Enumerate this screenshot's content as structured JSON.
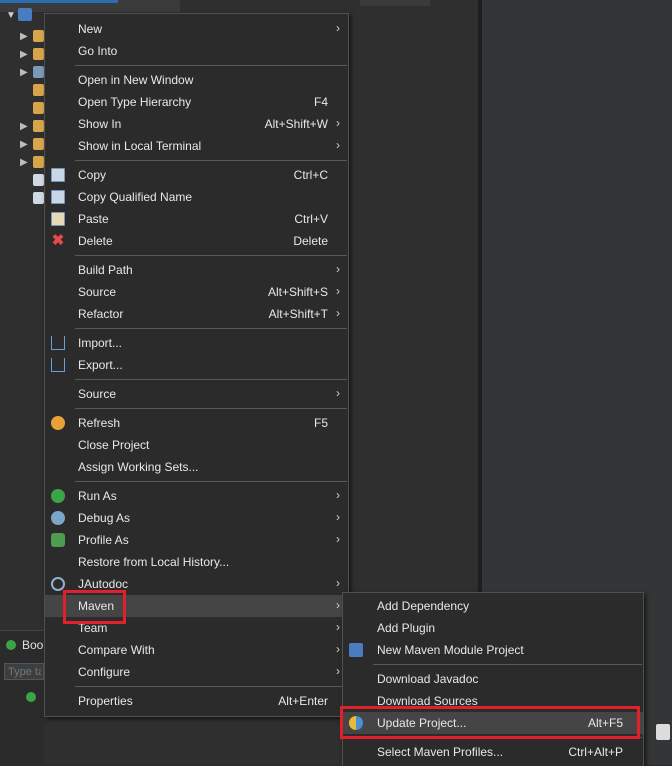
{
  "bottom_panel": {
    "tab_label": "Boo",
    "filter_placeholder": "Type ta"
  },
  "context_menu": {
    "items": [
      {
        "label": "New",
        "shortcut": "",
        "submenu": true
      },
      {
        "label": "Go Into",
        "shortcut": "",
        "submenu": false
      },
      {
        "label": "Open in New Window",
        "shortcut": "",
        "submenu": false
      },
      {
        "label": "Open Type Hierarchy",
        "shortcut": "F4",
        "submenu": false
      },
      {
        "label": "Show In",
        "shortcut": "Alt+Shift+W",
        "submenu": true
      },
      {
        "label": "Show in Local Terminal",
        "shortcut": "",
        "submenu": true
      },
      {
        "label": "Copy",
        "shortcut": "Ctrl+C",
        "submenu": false,
        "icon": "copy-icon"
      },
      {
        "label": "Copy Qualified Name",
        "shortcut": "",
        "submenu": false,
        "icon": "copy-qualified-name-icon"
      },
      {
        "label": "Paste",
        "shortcut": "Ctrl+V",
        "submenu": false,
        "icon": "paste-icon"
      },
      {
        "label": "Delete",
        "shortcut": "Delete",
        "submenu": false,
        "icon": "delete-icon"
      },
      {
        "label": "Build Path",
        "shortcut": "",
        "submenu": true
      },
      {
        "label": "Source",
        "shortcut": "Alt+Shift+S",
        "submenu": true
      },
      {
        "label": "Refactor",
        "shortcut": "Alt+Shift+T",
        "submenu": true
      },
      {
        "label": "Import...",
        "shortcut": "",
        "submenu": false,
        "icon": "import-icon"
      },
      {
        "label": "Export...",
        "shortcut": "",
        "submenu": false,
        "icon": "export-icon"
      },
      {
        "label": "Source",
        "shortcut": "",
        "submenu": true
      },
      {
        "label": "Refresh",
        "shortcut": "F5",
        "submenu": false,
        "icon": "refresh-icon"
      },
      {
        "label": "Close Project",
        "shortcut": "",
        "submenu": false
      },
      {
        "label": "Assign Working Sets...",
        "shortcut": "",
        "submenu": false
      },
      {
        "label": "Run As",
        "shortcut": "",
        "submenu": true,
        "icon": "run-icon"
      },
      {
        "label": "Debug As",
        "shortcut": "",
        "submenu": true,
        "icon": "debug-icon"
      },
      {
        "label": "Profile As",
        "shortcut": "",
        "submenu": true,
        "icon": "profile-icon"
      },
      {
        "label": "Restore from Local History...",
        "shortcut": "",
        "submenu": false
      },
      {
        "label": "JAutodoc",
        "shortcut": "",
        "submenu": true,
        "icon": "jautodoc-icon"
      },
      {
        "label": "Maven",
        "shortcut": "",
        "submenu": true,
        "active": true
      },
      {
        "label": "Team",
        "shortcut": "",
        "submenu": true
      },
      {
        "label": "Compare With",
        "shortcut": "",
        "submenu": true
      },
      {
        "label": "Configure",
        "shortcut": "",
        "submenu": true
      },
      {
        "label": "Properties",
        "shortcut": "Alt+Enter",
        "submenu": false
      }
    ]
  },
  "maven_submenu": {
    "items": [
      {
        "label": "Add Dependency",
        "shortcut": ""
      },
      {
        "label": "Add Plugin",
        "shortcut": ""
      },
      {
        "label": "New Maven Module Project",
        "shortcut": "",
        "icon": "maven-module-icon"
      },
      {
        "label": "Download Javadoc",
        "shortcut": ""
      },
      {
        "label": "Download Sources",
        "shortcut": ""
      },
      {
        "label": "Update Project...",
        "shortcut": "Alt+F5",
        "icon": "update-project-icon",
        "active": true
      },
      {
        "label": "Select Maven Profiles...",
        "shortcut": "Ctrl+Alt+P"
      }
    ]
  },
  "colors": {
    "highlight_box": "#e0202a",
    "menu_background": "#2b2b2b",
    "menu_hover": "#454545"
  }
}
